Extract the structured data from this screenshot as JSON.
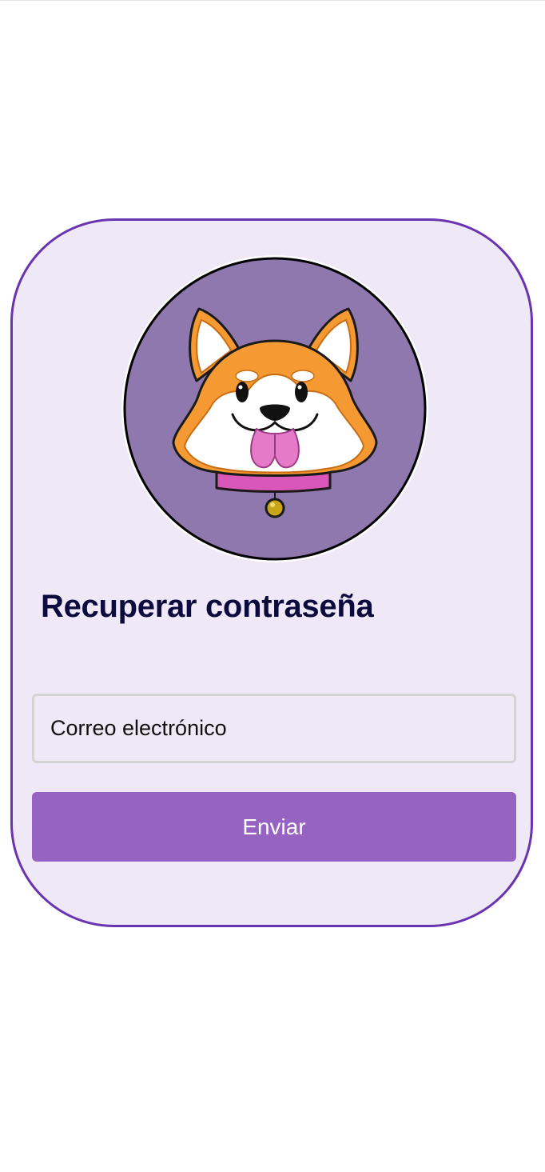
{
  "page": {
    "title": "Recuperar contraseña"
  },
  "logo": {
    "icon": "corgi-dog-logo"
  },
  "form": {
    "email_placeholder": "Correo electrónico",
    "email_value": "",
    "submit_label": "Enviar"
  },
  "colors": {
    "card_background": "#efe8f6",
    "card_border": "#6a33b0",
    "logo_circle": "#8f78ad",
    "button": "#9763c3",
    "title_text": "#0d0b3d",
    "corgi_orange": "#f59a33",
    "collar": "#d957b8"
  }
}
